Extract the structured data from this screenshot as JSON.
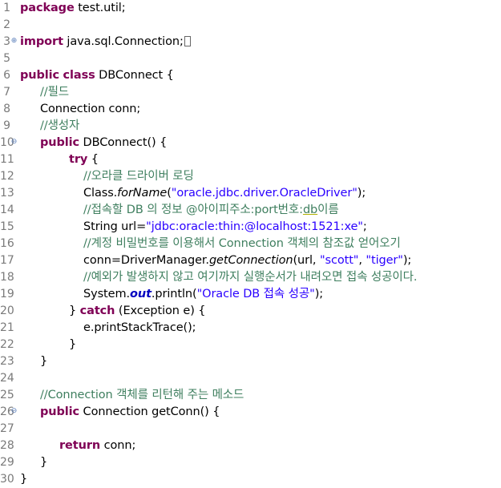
{
  "editor": {
    "lines": [
      {
        "n": "1",
        "segs": [
          {
            "t": "package",
            "c": "kw"
          },
          {
            "t": " test.util;"
          }
        ]
      },
      {
        "n": "2",
        "segs": []
      },
      {
        "n": "3",
        "fold": "plus",
        "segs": [
          {
            "t": "import",
            "c": "kw"
          },
          {
            "t": " java.sql.Connection;"
          },
          {
            "t": "",
            "c": "box"
          }
        ]
      },
      {
        "n": "5",
        "segs": []
      },
      {
        "n": "6",
        "segs": [
          {
            "t": "public",
            "c": "kw"
          },
          {
            "t": " "
          },
          {
            "t": "class",
            "c": "kw"
          },
          {
            "t": " DBConnect {"
          }
        ]
      },
      {
        "n": "7",
        "segs": [
          {
            "t": "//필드",
            "c": "cm"
          }
        ]
      },
      {
        "n": "8",
        "segs": [
          {
            "t": "Connection conn;"
          }
        ]
      },
      {
        "n": "9",
        "segs": [
          {
            "t": "//생성자",
            "c": "cm"
          }
        ]
      },
      {
        "n": "10",
        "fold": "minus",
        "segs": [
          {
            "t": "public",
            "c": "kw"
          },
          {
            "t": " DBConnect() {"
          }
        ]
      },
      {
        "n": "11",
        "segs": [
          {
            "t": "try",
            "c": "kw"
          },
          {
            "t": " {"
          }
        ]
      },
      {
        "n": "12",
        "segs": [
          {
            "t": "//오라클 드라이버 로딩",
            "c": "cm"
          }
        ]
      },
      {
        "n": "13",
        "segs": [
          {
            "t": "Class."
          },
          {
            "t": "forName",
            "c": "it"
          },
          {
            "t": "("
          },
          {
            "t": "\"oracle.jdbc.driver.OracleDriver\"",
            "c": "st"
          },
          {
            "t": ");"
          }
        ]
      },
      {
        "n": "14",
        "segs": [
          {
            "t": "//접속할 DB 의 정보 @아이피주소:port번호:",
            "c": "cm"
          },
          {
            "t": "db",
            "c": "cm ul"
          },
          {
            "t": "이름",
            "c": "cm"
          }
        ]
      },
      {
        "n": "15",
        "segs": [
          {
            "t": "String url="
          },
          {
            "t": "\"jdbc:oracle:thin:@localhost:1521:xe\"",
            "c": "st"
          },
          {
            "t": ";"
          }
        ]
      },
      {
        "n": "16",
        "segs": [
          {
            "t": "//계정 비밀번호를 이용해서 Connection 객체의 참조값 얻어오기",
            "c": "cm"
          }
        ]
      },
      {
        "n": "17",
        "segs": [
          {
            "t": "conn=DriverManager."
          },
          {
            "t": "getConnection",
            "c": "it"
          },
          {
            "t": "(url, "
          },
          {
            "t": "\"scott\"",
            "c": "st"
          },
          {
            "t": ", "
          },
          {
            "t": "\"tiger\"",
            "c": "st"
          },
          {
            "t": ");"
          }
        ]
      },
      {
        "n": "18",
        "segs": [
          {
            "t": "//예외가 발생하지 않고 여기까지 실행순서가 내려오면 접속 성공이다.",
            "c": "cm"
          }
        ]
      },
      {
        "n": "19",
        "segs": [
          {
            "t": "System."
          },
          {
            "t": "out",
            "c": "fl"
          },
          {
            "t": ".println("
          },
          {
            "t": "\"Oracle DB 접속 성공\"",
            "c": "st"
          },
          {
            "t": ");"
          }
        ]
      },
      {
        "n": "20",
        "segs": [
          {
            "t": "} "
          },
          {
            "t": "catch",
            "c": "kw"
          },
          {
            "t": " (Exception e) {"
          }
        ]
      },
      {
        "n": "21",
        "segs": [
          {
            "t": "e.printStackTrace();"
          }
        ]
      },
      {
        "n": "22",
        "segs": [
          {
            "t": "}"
          }
        ]
      },
      {
        "n": "23",
        "segs": [
          {
            "t": "}"
          }
        ]
      },
      {
        "n": "24",
        "segs": []
      },
      {
        "n": "25",
        "segs": [
          {
            "t": "//Connection 객체를 리턴해 주는 메소드",
            "c": "cm"
          }
        ]
      },
      {
        "n": "26",
        "fold": "minus",
        "segs": [
          {
            "t": "public",
            "c": "kw"
          },
          {
            "t": " Connection getConn() {"
          }
        ]
      },
      {
        "n": "27",
        "segs": []
      },
      {
        "n": "28",
        "segs": [
          {
            "t": "return",
            "c": "kw"
          },
          {
            "t": " conn;"
          }
        ]
      },
      {
        "n": "29",
        "segs": [
          {
            "t": "}"
          }
        ]
      },
      {
        "n": "30",
        "segs": [
          {
            "t": "}"
          }
        ]
      }
    ]
  }
}
